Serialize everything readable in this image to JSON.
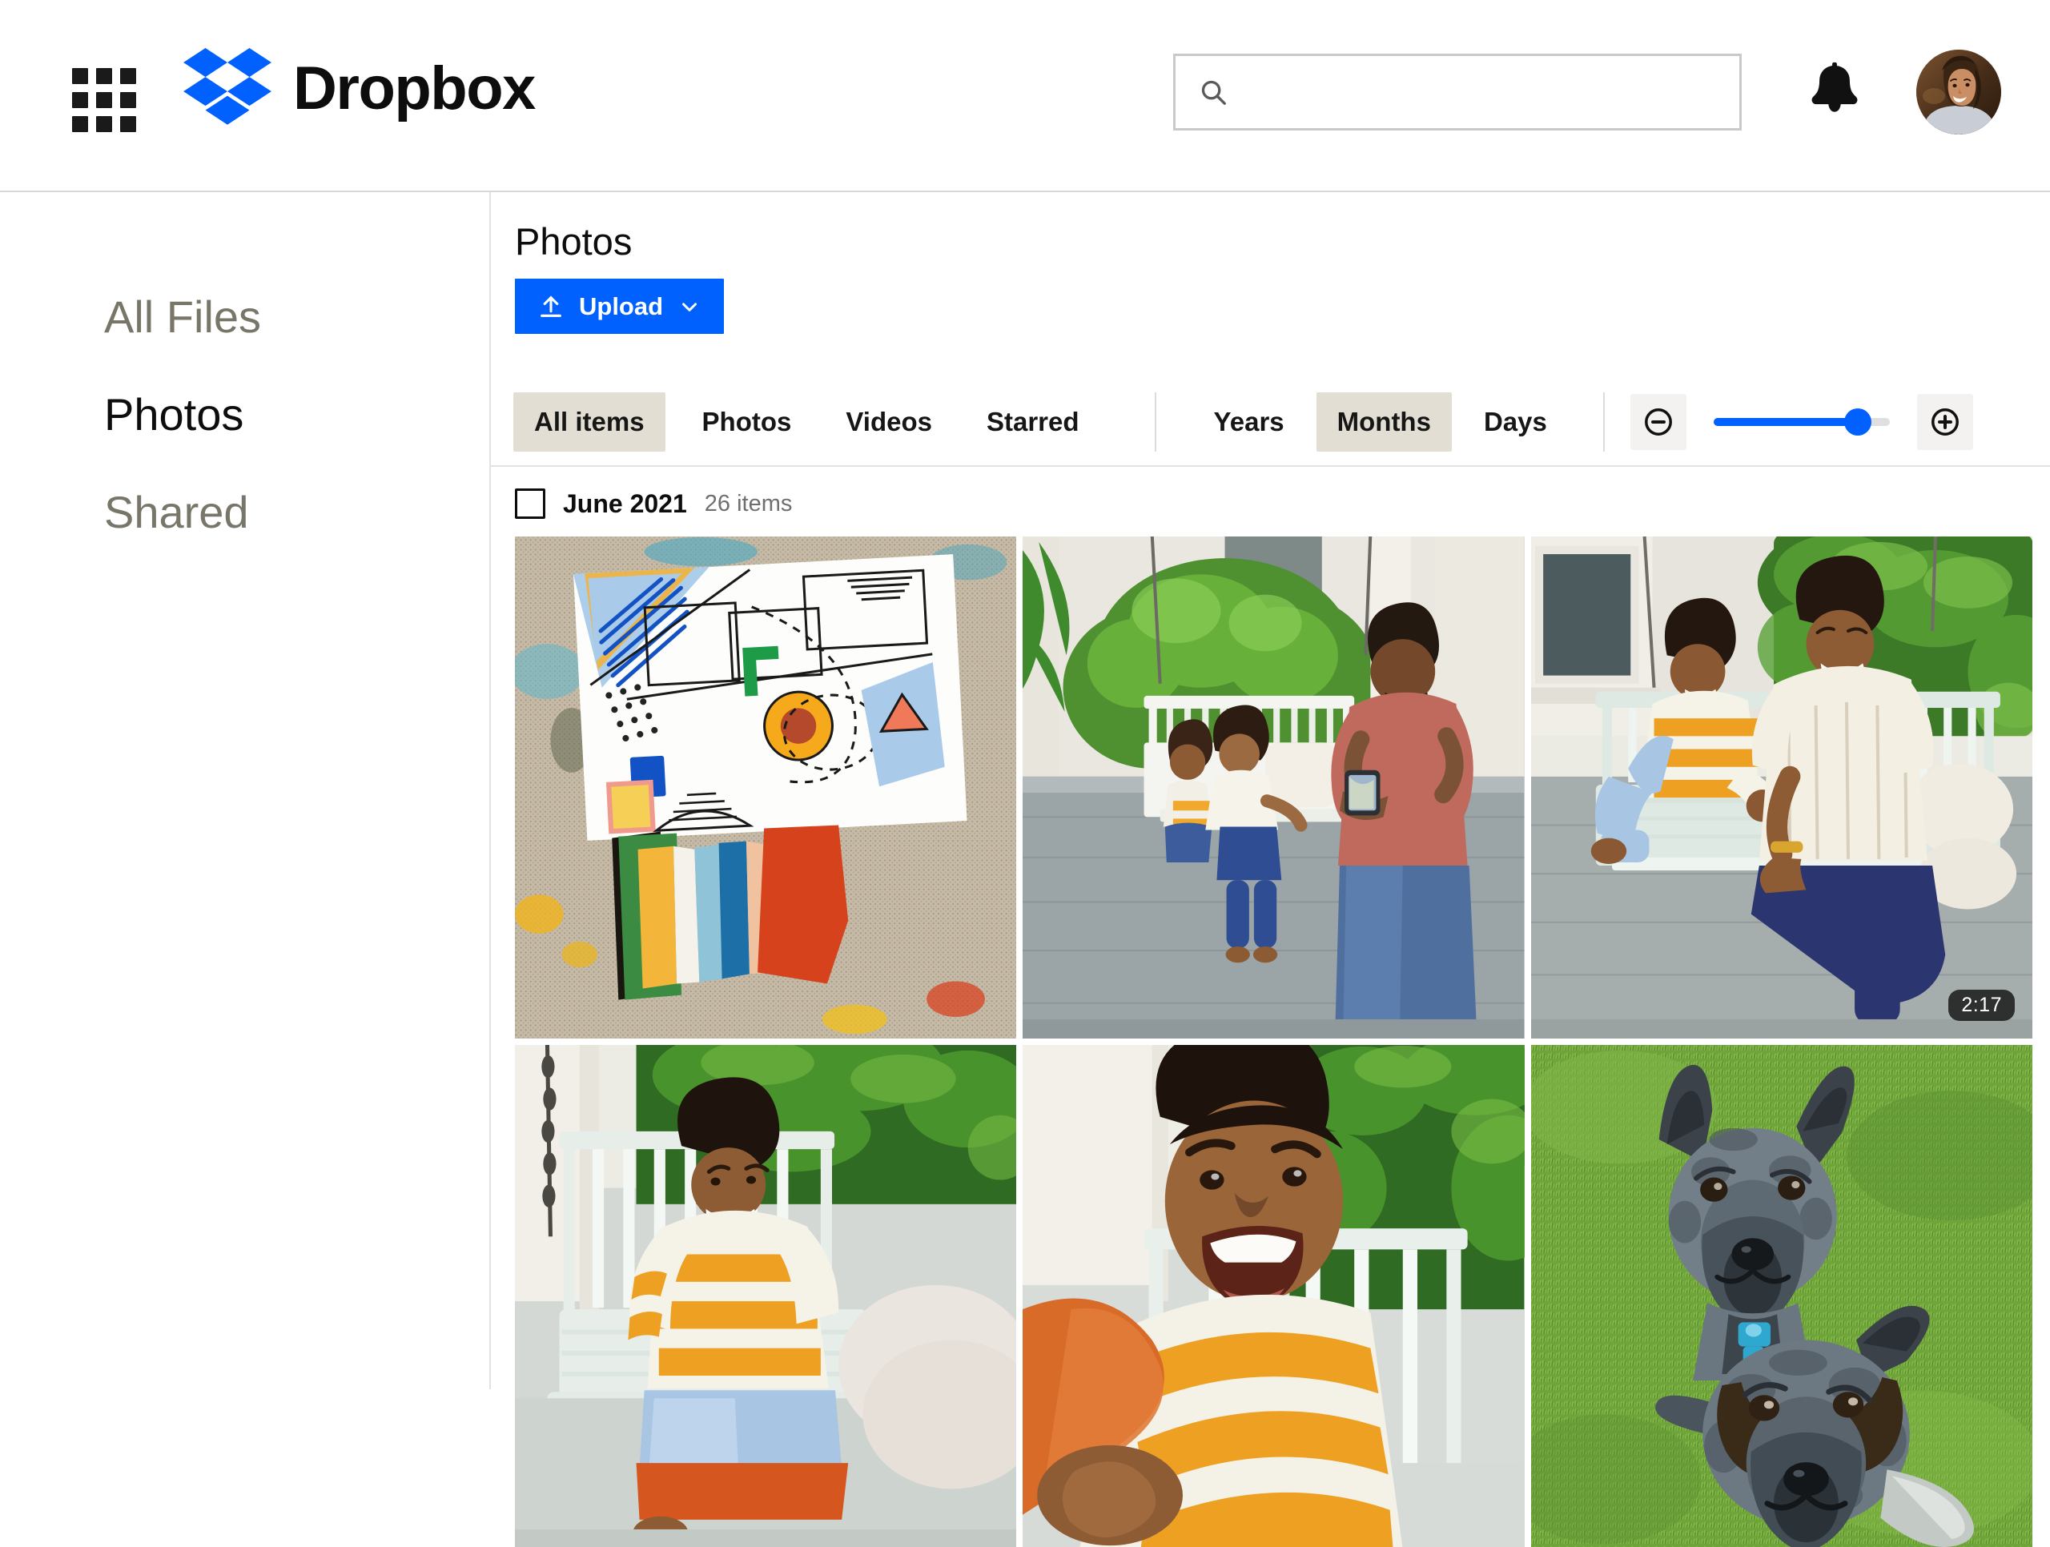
{
  "header": {
    "app_launcher_icon": "grid-apps-icon",
    "brand_name": "Dropbox",
    "brand_logo_icon": "dropbox-logo-icon",
    "brand_blue": "#0061fe",
    "search": {
      "icon": "search-icon",
      "value": "",
      "placeholder": ""
    },
    "notifications_icon": "bell-icon",
    "avatar_icon": "user-avatar"
  },
  "sidebar": {
    "items": [
      {
        "label": "All Files",
        "active": false
      },
      {
        "label": "Photos",
        "active": true
      },
      {
        "label": "Shared",
        "active": false
      }
    ]
  },
  "main": {
    "page_title": "Photos",
    "upload": {
      "label": "Upload",
      "icon": "upload-arrow-icon",
      "chevron_icon": "chevron-down-icon",
      "color": "#0061fe"
    },
    "toolbar": {
      "type_filters": [
        {
          "label": "All items",
          "active": true
        },
        {
          "label": "Photos",
          "active": false
        },
        {
          "label": "Videos",
          "active": false
        },
        {
          "label": "Starred",
          "active": false
        }
      ],
      "time_filters": [
        {
          "label": "Years",
          "active": false
        },
        {
          "label": "Months",
          "active": true
        },
        {
          "label": "Days",
          "active": false
        }
      ],
      "zoom_out_icon": "minus-circle-icon",
      "zoom_in_icon": "plus-circle-icon",
      "zoom_level": 82,
      "active_bg": "#e3ded3"
    },
    "group": {
      "checkbox_checked": false,
      "title": "June 2021",
      "count": "26 items"
    },
    "tiles": [
      {
        "name": "abstract-art-collage",
        "duration": null
      },
      {
        "name": "family-photographed-on-porch-swing",
        "duration": null
      },
      {
        "name": "mother-and-son-on-porch-swing",
        "duration": "2:17"
      },
      {
        "name": "boy-sitting-on-porch-swing",
        "duration": null
      },
      {
        "name": "boy-selfie-close-up",
        "duration": null
      },
      {
        "name": "two-blue-heeler-dogs-on-grass",
        "duration": null
      }
    ]
  }
}
